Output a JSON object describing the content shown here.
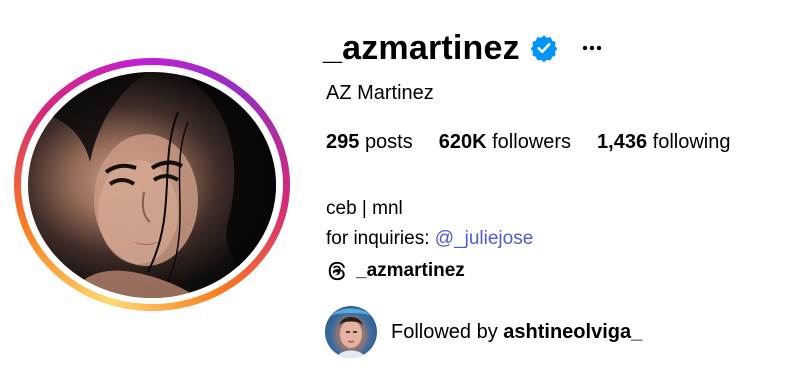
{
  "profile": {
    "username": "_azmartinez",
    "full_name": "AZ Martinez",
    "verified": true,
    "stats": {
      "posts_count": "295",
      "posts_label": "posts",
      "followers_count": "620K",
      "followers_label": "followers",
      "following_count": "1,436",
      "following_label": "following"
    },
    "bio": {
      "line1": "ceb | mnl",
      "inquiries_prefix": "for inquiries: ",
      "mention": "@_juliejose",
      "threads_handle": "_azmartinez"
    },
    "followed_by": {
      "prefix": "Followed by ",
      "name": "ashtineolviga_"
    }
  },
  "icons": {
    "verified": "verified-badge-icon",
    "more": "more-options-icon",
    "threads": "threads-icon"
  },
  "colors": {
    "verified_blue": "#0095f6",
    "mention_link": "#4f5bd5",
    "text": "#000000"
  }
}
